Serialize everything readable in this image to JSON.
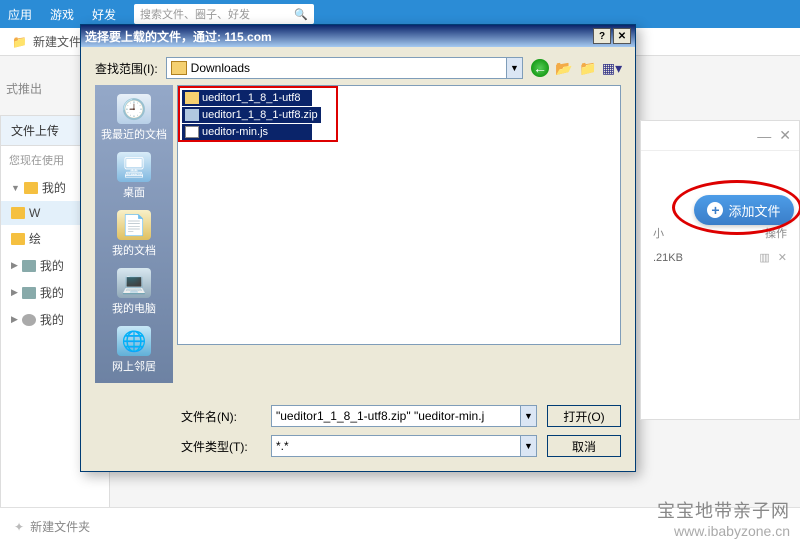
{
  "topbar": {
    "nav1": "应用",
    "nav2": "游戏",
    "nav3": "好发",
    "search_placeholder": "搜索文件、圈子、好发"
  },
  "toolbar": {
    "new_folder": "新建文件夹"
  },
  "sub_text": "式推出",
  "left": {
    "title": "文件上传",
    "hint": "您现在使用",
    "items": [
      {
        "label": "我的"
      },
      {
        "label": "W"
      },
      {
        "label": "绘"
      },
      {
        "label": "我的"
      },
      {
        "label": "我的"
      },
      {
        "label": "我的"
      }
    ]
  },
  "dialog": {
    "title": "选择要上载的文件，通过: 115.com",
    "look_in_label": "查找范围(I):",
    "look_in_value": "Downloads",
    "places": {
      "recent": "我最近的文档",
      "desktop": "桌面",
      "docs": "我的文档",
      "computer": "我的电脑",
      "network": "网上邻居"
    },
    "files": [
      {
        "name": "ueditor1_1_8_1-utf8",
        "type": "folder"
      },
      {
        "name": "ueditor1_1_8_1-utf8.zip",
        "type": "zip"
      },
      {
        "name": "ueditor-min.js",
        "type": "js"
      }
    ],
    "filename_label": "文件名(N):",
    "filename_value": "\"ueditor1_1_8_1-utf8.zip\" \"ueditor-min.j",
    "filetype_label": "文件类型(T):",
    "filetype_value": "*.*",
    "open_btn": "打开(O)",
    "cancel_btn": "取消"
  },
  "right": {
    "add_file": "添加文件",
    "col_size": "小",
    "col_ops": "操作",
    "row_size": ".21KB"
  },
  "bottom": {
    "new_folder": "新建文件夹"
  },
  "watermark": {
    "line1": "宝宝地带亲子网",
    "line2": "www.ibabyzone.cn"
  }
}
